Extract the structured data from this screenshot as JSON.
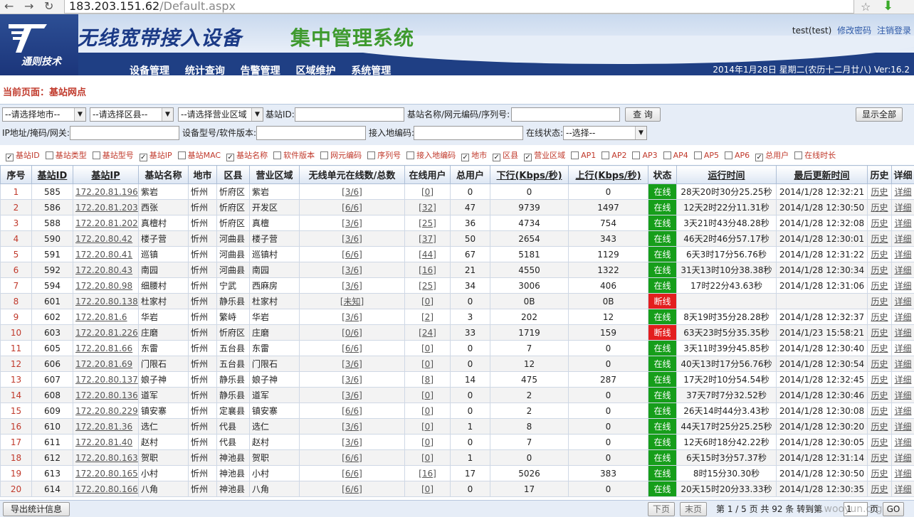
{
  "browser": {
    "url_host": "183.203.151.62",
    "url_path": "/Default.aspx"
  },
  "header": {
    "logo_text": "通则技术",
    "title_a": "无线宽带接入设备",
    "title_b": "集中管理系统",
    "user": "test(test)",
    "change_password": "修改密码",
    "logout": "注销登录",
    "date": "2014年1月28日 星期二(农历十二月廿八) Ver:16.2",
    "nav": [
      "设备管理",
      "统计查询",
      "告警管理",
      "区域维护",
      "系统管理"
    ]
  },
  "breadcrumb": "当前页面：基站网点",
  "filters": {
    "city_select": "--请选择地市--",
    "county_select": "--请选择区县--",
    "area_select": "--请选择营业区域",
    "station_id_label": "基站ID:",
    "station_name_label": "基站名称/网元编码/序列号:",
    "query_button": "查 询",
    "show_all_button": "显示全部",
    "ip_label": "IP地址/掩码/网关:",
    "model_label": "设备型号/软件版本:",
    "access_code_label": "接入地编码:",
    "online_status_label": "在线状态:",
    "online_status_select": "--选择--"
  },
  "columns_toggle": [
    {
      "label": "基站ID",
      "checked": true
    },
    {
      "label": "基站类型",
      "checked": false
    },
    {
      "label": "基站型号",
      "checked": false
    },
    {
      "label": "基站IP",
      "checked": true
    },
    {
      "label": "基站MAC",
      "checked": false
    },
    {
      "label": "基站名称",
      "checked": true
    },
    {
      "label": "软件版本",
      "checked": false
    },
    {
      "label": "网元编码",
      "checked": false
    },
    {
      "label": "序列号",
      "checked": false
    },
    {
      "label": "接入地编码",
      "checked": false
    },
    {
      "label": "地市",
      "checked": true
    },
    {
      "label": "区县",
      "checked": true
    },
    {
      "label": "营业区域",
      "checked": true
    },
    {
      "label": "AP1",
      "checked": false
    },
    {
      "label": "AP2",
      "checked": false
    },
    {
      "label": "AP3",
      "checked": false
    },
    {
      "label": "AP4",
      "checked": false
    },
    {
      "label": "AP5",
      "checked": false
    },
    {
      "label": "AP6",
      "checked": false
    },
    {
      "label": "总用户",
      "checked": true
    },
    {
      "label": "在线时长",
      "checked": false
    }
  ],
  "table": {
    "headers": [
      "序号",
      "基站ID",
      "基站IP",
      "基站名称",
      "地市",
      "区县",
      "营业区域",
      "无线单元在线数/总数",
      "在线用户",
      "总用户",
      "下行(Kbps/秒)",
      "上行(Kbps/秒)",
      "状态",
      "运行时间",
      "最后更新时间",
      "历史",
      "详细"
    ],
    "history_label": "历史",
    "detail_label": "详细",
    "rows": [
      {
        "no": "1",
        "id": "585",
        "ip": "172.20.81.196",
        "name": "紫岩",
        "city": "忻州",
        "county": "忻府区",
        "area": "紫岩",
        "units": "[3/6]",
        "online": "[0]",
        "total": "0",
        "down": "0",
        "up": "0",
        "status": "在线",
        "runtime": "28天20时30分25.25秒",
        "updated": "2014/1/28 12:32:21"
      },
      {
        "no": "2",
        "id": "586",
        "ip": "172.20.81.203",
        "name": "西张",
        "city": "忻州",
        "county": "忻府区",
        "area": "开发区",
        "units": "[6/6]",
        "online": "[32]",
        "total": "47",
        "down": "9739",
        "up": "1497",
        "status": "在线",
        "runtime": "12天2时22分11.31秒",
        "updated": "2014/1/28 12:30:50"
      },
      {
        "no": "3",
        "id": "588",
        "ip": "172.20.81.202",
        "name": "真檀村",
        "city": "忻州",
        "county": "忻府区",
        "area": "真檀",
        "units": "[3/6]",
        "online": "[25]",
        "total": "36",
        "down": "4734",
        "up": "754",
        "status": "在线",
        "runtime": "3天21时43分48.28秒",
        "updated": "2014/1/28 12:32:08"
      },
      {
        "no": "4",
        "id": "590",
        "ip": "172.20.80.42",
        "name": "楼子营",
        "city": "忻州",
        "county": "河曲县",
        "area": "楼子营",
        "units": "[3/6]",
        "online": "[37]",
        "total": "50",
        "down": "2654",
        "up": "343",
        "status": "在线",
        "runtime": "46天2时46分57.17秒",
        "updated": "2014/1/28 12:30:01"
      },
      {
        "no": "5",
        "id": "591",
        "ip": "172.20.80.41",
        "name": "巡镇",
        "city": "忻州",
        "county": "河曲县",
        "area": "巡镇村",
        "units": "[6/6]",
        "online": "[44]",
        "total": "67",
        "down": "5181",
        "up": "1129",
        "status": "在线",
        "runtime": "6天3时17分56.76秒",
        "updated": "2014/1/28 12:31:22"
      },
      {
        "no": "6",
        "id": "592",
        "ip": "172.20.80.43",
        "name": "南园",
        "city": "忻州",
        "county": "河曲县",
        "area": "南园",
        "units": "[3/6]",
        "online": "[16]",
        "total": "21",
        "down": "4550",
        "up": "1322",
        "status": "在线",
        "runtime": "31天13时10分38.38秒",
        "updated": "2014/1/28 12:30:34"
      },
      {
        "no": "7",
        "id": "594",
        "ip": "172.20.80.98",
        "name": "细腰村",
        "city": "忻州",
        "county": "宁武",
        "area": "西麻房",
        "units": "[3/6]",
        "online": "[25]",
        "total": "34",
        "down": "3006",
        "up": "406",
        "status": "在线",
        "runtime": "17时22分43.63秒",
        "updated": "2014/1/28 12:31:06"
      },
      {
        "no": "8",
        "id": "601",
        "ip": "172.20.80.138",
        "name": "杜家村",
        "city": "忻州",
        "county": "静乐县",
        "area": "杜家村",
        "units": "[未知]",
        "online": "[0]",
        "total": "0",
        "down": "0B",
        "up": "0B",
        "status": "断线",
        "runtime": "",
        "updated": ""
      },
      {
        "no": "9",
        "id": "602",
        "ip": "172.20.81.6",
        "name": "华岩",
        "city": "忻州",
        "county": "繁峙",
        "area": "华岩",
        "units": "[3/6]",
        "online": "[2]",
        "total": "3",
        "down": "202",
        "up": "12",
        "status": "在线",
        "runtime": "8天19时35分28.28秒",
        "updated": "2014/1/28 12:32:37"
      },
      {
        "no": "10",
        "id": "603",
        "ip": "172.20.81.226",
        "name": "庄磨",
        "city": "忻州",
        "county": "忻府区",
        "area": "庄磨",
        "units": "[0/6]",
        "online": "[24]",
        "total": "33",
        "down": "1719",
        "up": "159",
        "status": "断线",
        "runtime": "63天23时5分35.35秒",
        "updated": "2014/1/23 15:58:21"
      },
      {
        "no": "11",
        "id": "605",
        "ip": "172.20.81.66",
        "name": "东雷",
        "city": "忻州",
        "county": "五台县",
        "area": "东雷",
        "units": "[6/6]",
        "online": "[0]",
        "total": "0",
        "down": "7",
        "up": "0",
        "status": "在线",
        "runtime": "3天11时39分45.85秒",
        "updated": "2014/1/28 12:30:40"
      },
      {
        "no": "12",
        "id": "606",
        "ip": "172.20.81.69",
        "name": "门限石",
        "city": "忻州",
        "county": "五台县",
        "area": "门限石",
        "units": "[3/6]",
        "online": "[0]",
        "total": "0",
        "down": "12",
        "up": "0",
        "status": "在线",
        "runtime": "40天13时17分56.76秒",
        "updated": "2014/1/28 12:30:54"
      },
      {
        "no": "13",
        "id": "607",
        "ip": "172.20.80.137",
        "name": "娘子神",
        "city": "忻州",
        "county": "静乐县",
        "area": "娘子神",
        "units": "[3/6]",
        "online": "[8]",
        "total": "14",
        "down": "475",
        "up": "287",
        "status": "在线",
        "runtime": "17天2时10分54.54秒",
        "updated": "2014/1/28 12:32:45"
      },
      {
        "no": "14",
        "id": "608",
        "ip": "172.20.80.136",
        "name": "道军",
        "city": "忻州",
        "county": "静乐县",
        "area": "道军",
        "units": "[3/6]",
        "online": "[0]",
        "total": "0",
        "down": "2",
        "up": "0",
        "status": "在线",
        "runtime": "37天7时7分32.52秒",
        "updated": "2014/1/28 12:30:46"
      },
      {
        "no": "15",
        "id": "609",
        "ip": "172.20.80.229",
        "name": "镇安寨",
        "city": "忻州",
        "county": "定襄县",
        "area": "镇安寨",
        "units": "[6/6]",
        "online": "[0]",
        "total": "0",
        "down": "2",
        "up": "0",
        "status": "在线",
        "runtime": "26天14时44分3.43秒",
        "updated": "2014/1/28 12:30:08"
      },
      {
        "no": "16",
        "id": "610",
        "ip": "172.20.81.36",
        "name": "选仁",
        "city": "忻州",
        "county": "代县",
        "area": "选仁",
        "units": "[3/6]",
        "online": "[0]",
        "total": "1",
        "down": "8",
        "up": "0",
        "status": "在线",
        "runtime": "44天17时25分25.25秒",
        "updated": "2014/1/28 12:30:20"
      },
      {
        "no": "17",
        "id": "611",
        "ip": "172.20.81.40",
        "name": "赵村",
        "city": "忻州",
        "county": "代县",
        "area": "赵村",
        "units": "[3/6]",
        "online": "[0]",
        "total": "0",
        "down": "7",
        "up": "0",
        "status": "在线",
        "runtime": "12天6时18分42.22秒",
        "updated": "2014/1/28 12:30:05"
      },
      {
        "no": "18",
        "id": "612",
        "ip": "172.20.80.163",
        "name": "贺职",
        "city": "忻州",
        "county": "神池县",
        "area": "贺职",
        "units": "[6/6]",
        "online": "[0]",
        "total": "1",
        "down": "0",
        "up": "0",
        "status": "在线",
        "runtime": "6天15时3分57.37秒",
        "updated": "2014/1/28 12:31:14"
      },
      {
        "no": "19",
        "id": "613",
        "ip": "172.20.80.165",
        "name": "小村",
        "city": "忻州",
        "county": "神池县",
        "area": "小村",
        "units": "[6/6]",
        "online": "[16]",
        "total": "17",
        "down": "5026",
        "up": "383",
        "status": "在线",
        "runtime": "8时15分30.30秒",
        "updated": "2014/1/28 12:30:50"
      },
      {
        "no": "20",
        "id": "614",
        "ip": "172.20.80.166",
        "name": "八角",
        "city": "忻州",
        "county": "神池县",
        "area": "八角",
        "units": "[6/6]",
        "online": "[0]",
        "total": "0",
        "down": "17",
        "up": "0",
        "status": "在线",
        "runtime": "20天15时20分33.33秒",
        "updated": "2014/1/28 12:30:35"
      }
    ]
  },
  "footer": {
    "export_button": "导出统计信息",
    "prev_button": "下页",
    "last_button": "末页",
    "page_info": "第 1 / 5 页  共 92 条  转到第",
    "goto_value": "1",
    "page_suffix": "页",
    "go_button": "GO"
  },
  "watermark": "www.wooyun.org",
  "colors": {
    "online": "#169e1a",
    "offline": "#e31e1e",
    "accent_red": "#c0392b",
    "nav_blue": "#1f3f84",
    "title_green": "#3f9a2f"
  }
}
